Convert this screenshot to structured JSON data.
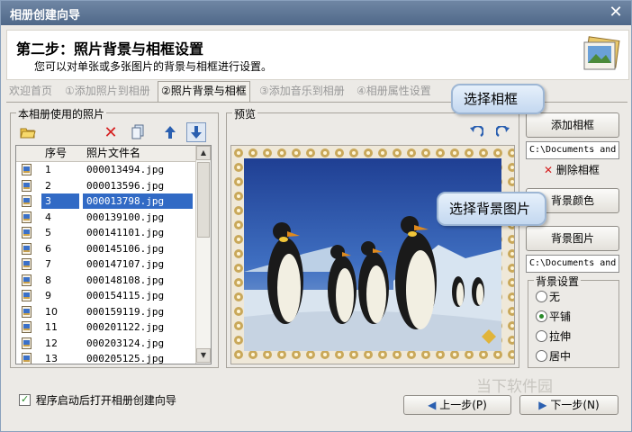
{
  "window": {
    "title": "相册创建向导"
  },
  "header": {
    "step_title": "第二步：照片背景与相框设置",
    "description": "您可以对单张或多张图片的背景与相框进行设置。"
  },
  "tabs": [
    {
      "label": "欢迎首页",
      "active": false
    },
    {
      "label": "①添加照片到相册",
      "active": false
    },
    {
      "label": "②照片背景与相框",
      "active": true
    },
    {
      "label": "③添加音乐到相册",
      "active": false
    },
    {
      "label": "④相册属性设置",
      "active": false
    }
  ],
  "photos_panel": {
    "label": "本相册使用的照片",
    "toolbar_icons": [
      "open-folder-icon",
      "delete-icon",
      "copy-icon",
      "move-up-icon",
      "move-down-icon"
    ],
    "columns": [
      "序号",
      "照片文件名"
    ],
    "rows": [
      {
        "num": "1",
        "file": "000013494.jpg",
        "selected": false
      },
      {
        "num": "2",
        "file": "000013596.jpg",
        "selected": false
      },
      {
        "num": "3",
        "file": "000013798.jpg",
        "selected": true
      },
      {
        "num": "4",
        "file": "000139100.jpg",
        "selected": false
      },
      {
        "num": "5",
        "file": "000141101.jpg",
        "selected": false
      },
      {
        "num": "6",
        "file": "000145106.jpg",
        "selected": false
      },
      {
        "num": "7",
        "file": "000147107.jpg",
        "selected": false
      },
      {
        "num": "8",
        "file": "000148108.jpg",
        "selected": false
      },
      {
        "num": "9",
        "file": "000154115.jpg",
        "selected": false
      },
      {
        "num": "10",
        "file": "000159119.jpg",
        "selected": false
      },
      {
        "num": "11",
        "file": "000201122.jpg",
        "selected": false
      },
      {
        "num": "12",
        "file": "000203124.jpg",
        "selected": false
      },
      {
        "num": "13",
        "file": "000205125.jpg",
        "selected": false
      }
    ]
  },
  "preview": {
    "label": "预览"
  },
  "frame_controls": {
    "add_frame": "添加相框",
    "frame_path": "C:\\Documents and",
    "delete_frame": "删除相框",
    "bg_color": "背景颜色",
    "bg_image": "背景图片",
    "bg_path": "C:\\Documents and"
  },
  "bg_settings": {
    "label": "背景设置",
    "options": [
      {
        "label": "无",
        "checked": false
      },
      {
        "label": "平铺",
        "checked": true
      },
      {
        "label": "拉伸",
        "checked": false
      },
      {
        "label": "居中",
        "checked": false
      }
    ]
  },
  "callouts": {
    "select_frame": "选择相框",
    "select_bg": "选择背景图片"
  },
  "footer": {
    "startup_checkbox": "程序启动后打开相册创建向导",
    "startup_checked": true,
    "prev": "上一步(P)",
    "next": "下一步(N)"
  },
  "watermark": "当下软件园",
  "colors": {
    "titlebar": "#4f6889",
    "selection": "#316ac5",
    "accent_icon": "#2a5fb0"
  }
}
